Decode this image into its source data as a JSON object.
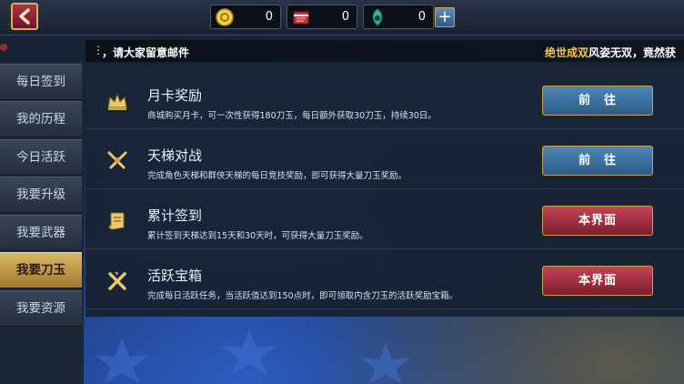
{
  "resources": [
    {
      "name": "gold-coin-icon",
      "value": "0"
    },
    {
      "name": "red-box-icon",
      "value": "0"
    },
    {
      "name": "jade-icon",
      "value": "0"
    }
  ],
  "marquee": {
    "dots": "⋮",
    "text_left": "，请大家留意邮件",
    "text_right_highlight": "绝世成双",
    "text_right_rest": "风姿无双，竟然获"
  },
  "sidebar": {
    "items": [
      {
        "label": "每日签到"
      },
      {
        "label": "我的历程"
      },
      {
        "label": "今日活跃"
      },
      {
        "label": "我要升级"
      },
      {
        "label": "我要武器"
      },
      {
        "label": "我要刀玉"
      },
      {
        "label": "我要资源"
      }
    ],
    "active_index": 5
  },
  "tasks": [
    {
      "title": "月卡奖励",
      "desc": "商城购买月卡，可一次性获得180刀玉，每日额外获取30刀玉，持续30日。",
      "button": "前　往",
      "style": "blue",
      "icon": "crown-icon"
    },
    {
      "title": "天梯对战",
      "desc": "完成角色天梯和群侠天梯的每日竞技奖励，即可获得大量刀玉奖励。",
      "button": "前　往",
      "style": "blue",
      "icon": "crossed-swords-icon"
    },
    {
      "title": "累计签到",
      "desc": "累计签到天梯达到15天和30天时，可获得大量刀玉奖励。",
      "button": "本界面",
      "style": "red",
      "icon": "scroll-icon"
    },
    {
      "title": "活跃宝箱",
      "desc": "完成每日活跃任务，当活跃值达到150点时，即可领取内含刀玉的活跃奖励宝箱。",
      "button": "本界面",
      "style": "red",
      "icon": "crossed-blades-icon"
    }
  ],
  "colors": {
    "accent_gold": "#d9b867",
    "button_blue": "#3b70a0",
    "button_red": "#a32f42"
  }
}
